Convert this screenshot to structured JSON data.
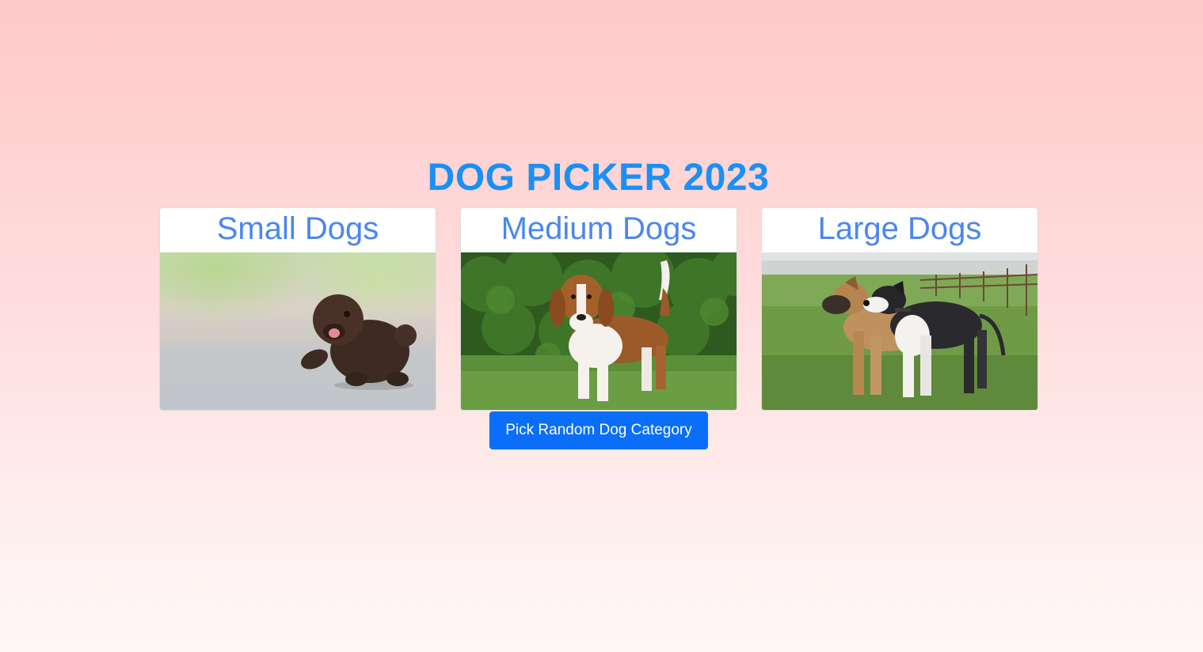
{
  "page": {
    "title": "DOG PICKER 2023"
  },
  "categories": [
    {
      "label": "Small Dogs",
      "image": "small-dog-photo"
    },
    {
      "label": "Medium Dogs",
      "image": "medium-dog-photo"
    },
    {
      "label": "Large Dogs",
      "image": "large-dogs-photo"
    }
  ],
  "actions": {
    "pick_label": "Pick Random Dog Category"
  },
  "colors": {
    "title": "#1a90f5",
    "card_title": "#4b86f0",
    "button": "#0a6ef9",
    "background_top": "#ffc9c9",
    "background_bottom": "#fff8f7"
  }
}
